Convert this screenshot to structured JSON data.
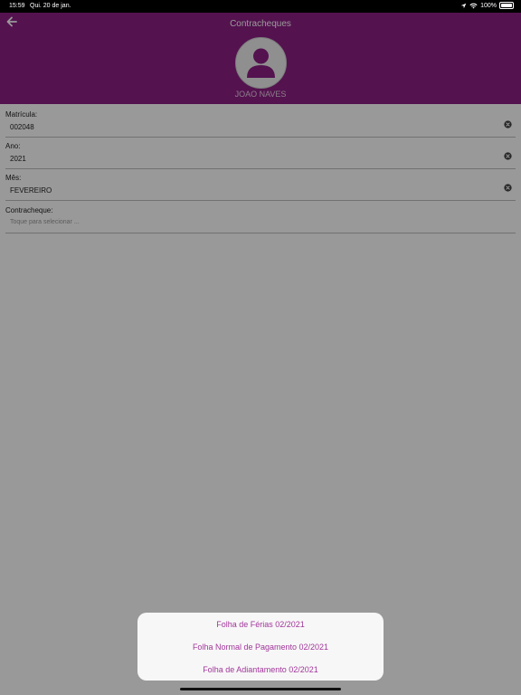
{
  "status_bar": {
    "time": "15:59",
    "date": "Qui. 20 de jan.",
    "battery": "100%"
  },
  "header": {
    "title": "Contracheques",
    "user_name": "JOAO NAVES",
    "background_color": "#8c1f84"
  },
  "form": {
    "matricula": {
      "label": "Matrícula:",
      "value": "002048"
    },
    "ano": {
      "label": "Ano:",
      "value": "2021"
    },
    "mes": {
      "label": "Mês:",
      "value": "FEVEREIRO"
    },
    "contracheque": {
      "label": "Contracheque:",
      "placeholder": "Toque para selecionar ..."
    }
  },
  "action_sheet": {
    "items": [
      "Folha de Férias 02/2021",
      "Folha Normal de Pagamento 02/2021",
      "Folha de Adiantamento 02/2021"
    ],
    "text_color": "#a1359a"
  }
}
